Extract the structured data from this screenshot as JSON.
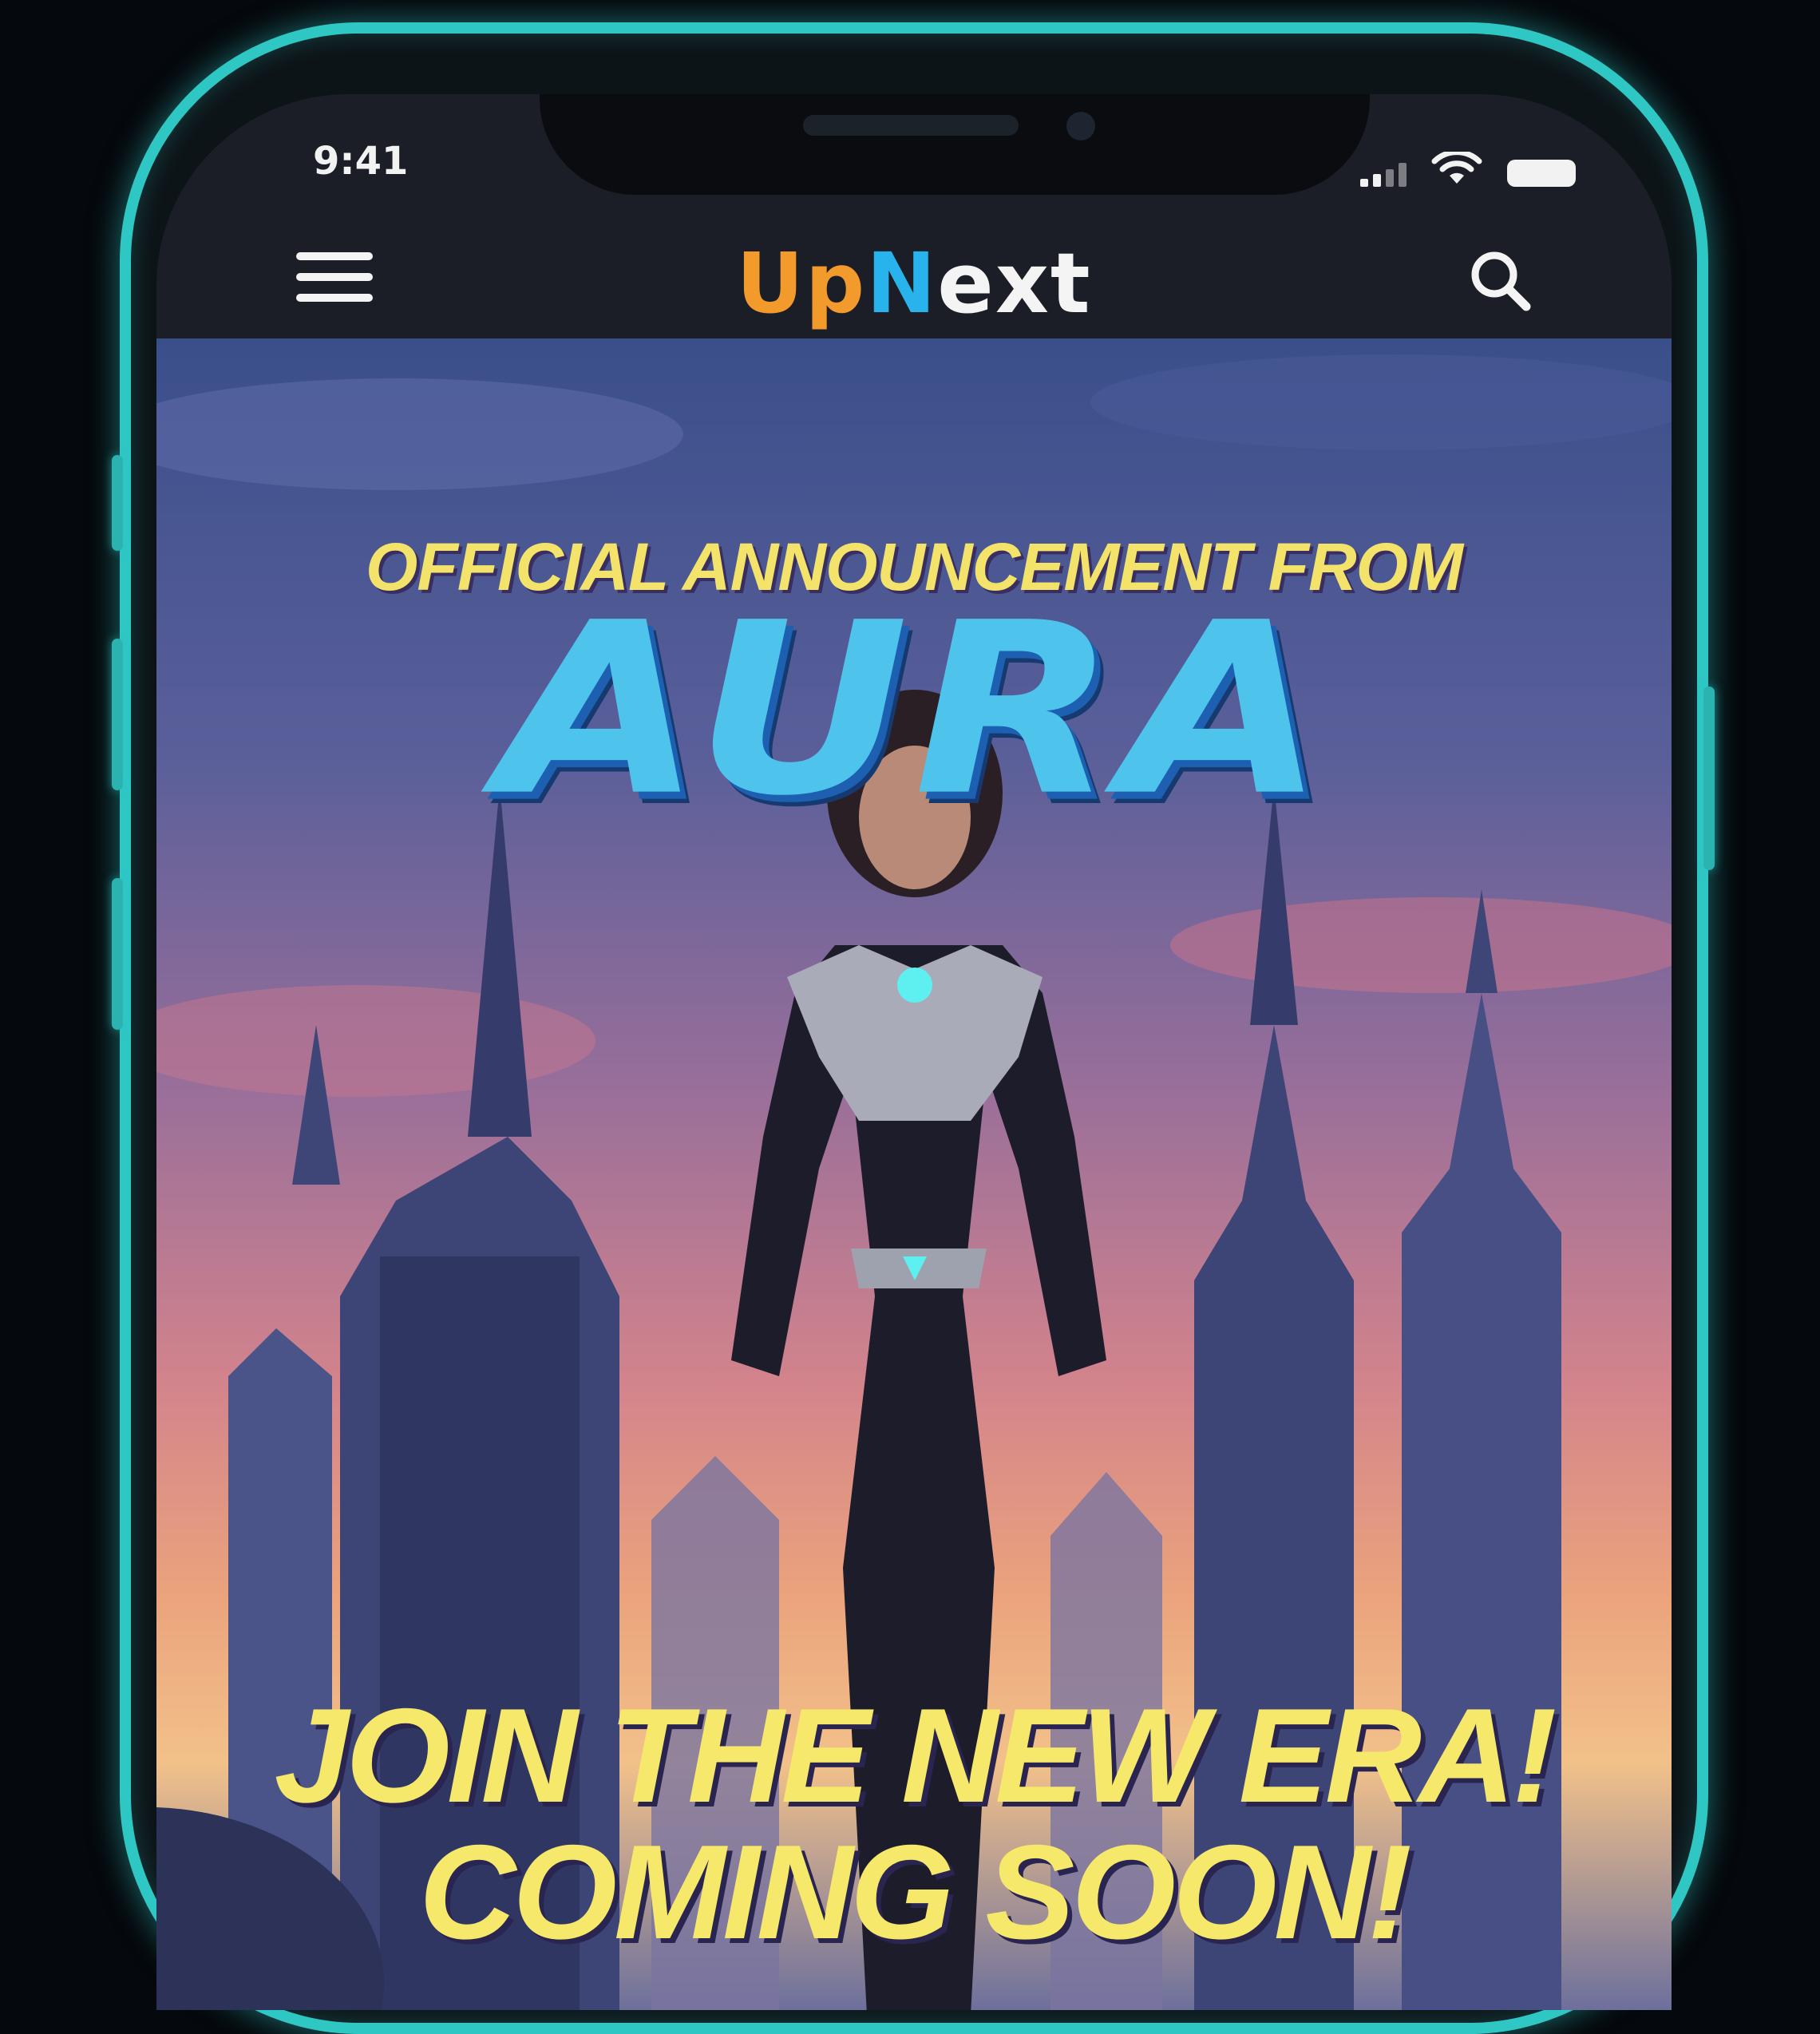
{
  "status_bar": {
    "time": "9:41",
    "icons": [
      "cellular-signal-icon",
      "wifi-icon",
      "battery-icon"
    ]
  },
  "nav": {
    "logo_part1": "Up",
    "logo_part2": "N",
    "logo_part3": "ext",
    "menu_icon": "hamburger-menu-icon",
    "search_icon": "search-icon"
  },
  "hero": {
    "headline": "OFFICIAL ANNOUNCEMENT FROM",
    "title": "AURA",
    "tagline_line1": "JOIN THE NEW ERA!",
    "tagline_line2": "COMING SOON!"
  },
  "colors": {
    "phone_frame": "#2fc7c4",
    "logo_orange": "#f39a2c",
    "logo_blue": "#29b3ec",
    "headline_yellow": "#f3e36a",
    "title_cyan": "#4ec3ec"
  }
}
